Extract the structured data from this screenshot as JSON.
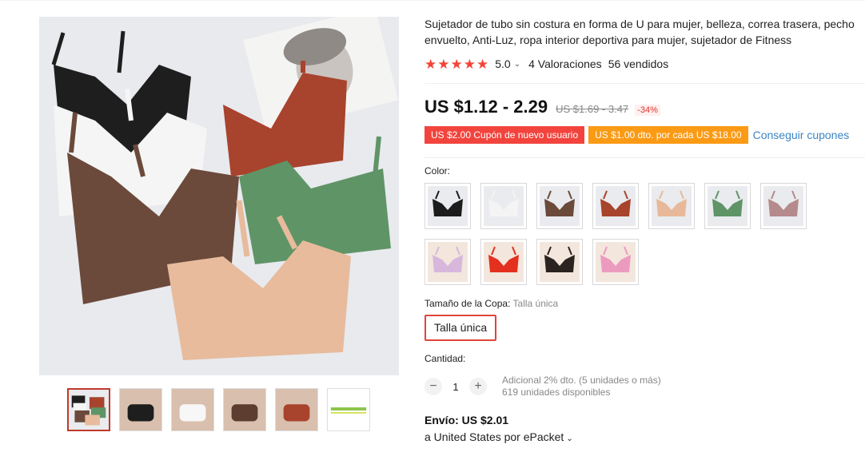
{
  "product": {
    "title": "Sujetador de tubo sin costura en forma de U para mujer, belleza, correa trasera, pecho envuelto, Anti-Luz, ropa interior deportiva para mujer, sujetador de Fitness",
    "rating": "5.0",
    "reviews": "4 Valoraciones",
    "sold": "56 vendidos",
    "price": "US $1.12 - 2.29",
    "old_price": "US $1.69 - 3.47",
    "discount": "-34%"
  },
  "coupons": {
    "new_user": "US $2.00 Cupón de nuevo usuario",
    "per_spend": "US $1.00 dto. por cada US $18.00",
    "get_link": "Conseguir cupones"
  },
  "color": {
    "label": "Color:",
    "swatches": [
      {
        "name": "black",
        "hex": "#1c1c1c"
      },
      {
        "name": "white",
        "hex": "#f4f4f4"
      },
      {
        "name": "brown",
        "hex": "#6b4a3a"
      },
      {
        "name": "rust",
        "hex": "#a8432c"
      },
      {
        "name": "nude",
        "hex": "#e8b999"
      },
      {
        "name": "green",
        "hex": "#5f9467"
      },
      {
        "name": "mauve",
        "hex": "#b58a8c"
      },
      {
        "name": "lilac-lace",
        "hex": "#d7b8dc"
      },
      {
        "name": "red-bikini",
        "hex": "#e4311f"
      },
      {
        "name": "black-bikini",
        "hex": "#2a2320"
      },
      {
        "name": "pink-lace",
        "hex": "#ec9bc0"
      }
    ]
  },
  "size": {
    "label": "Tamaño de la Copa:",
    "selected": "Talla única",
    "option": "Talla única"
  },
  "quantity": {
    "label": "Cantidad:",
    "value": "1",
    "minus": "−",
    "plus": "+",
    "discount_note": "Adicional 2% dto. (5 unidades o más)",
    "available": "619 unidades disponibles"
  },
  "shipping": {
    "cost": "Envío: US $2.01",
    "destination": "a United States por ePacket"
  },
  "icons": {
    "star": "★",
    "chevron": "⌄"
  },
  "colors": {
    "accent_red": "#f2443d",
    "accent_orange": "#fb9a14",
    "link_blue": "#3a85c6",
    "star_red": "#f44336"
  }
}
